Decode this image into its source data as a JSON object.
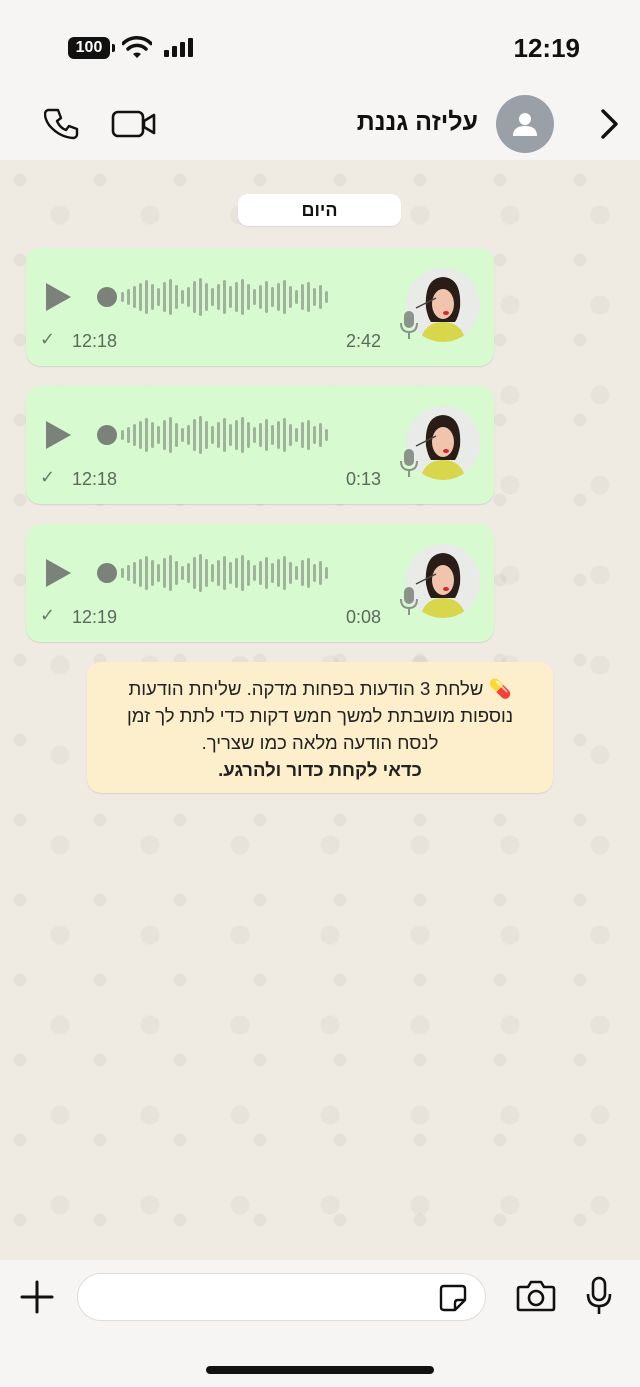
{
  "status_bar": {
    "battery": "100",
    "time": "12:19"
  },
  "header": {
    "contact_name": "עליזה גננת"
  },
  "chat": {
    "date_label": "היום",
    "voice_messages": [
      {
        "duration": "2:42",
        "time": "12:18"
      },
      {
        "duration": "0:13",
        "time": "12:18"
      },
      {
        "duration": "0:08",
        "time": "12:19"
      }
    ],
    "notice": {
      "emoji": "💊",
      "text": "שלחת 3 הודעות בפחות מדקה. שליחת הודעות נוספות מושבתת למשך חמש דקות כדי לתת לך זמן לנסח הודעה מלאה כמו שצריך.",
      "bold_text": "כדאי לקחת כדור ולהרגע."
    }
  },
  "composer": {
    "placeholder": ""
  },
  "icons": [
    "phone-icon",
    "video-icon",
    "person-icon",
    "chevron-right-icon",
    "play-icon",
    "mic-icon",
    "plus-icon",
    "sticker-icon",
    "camera-icon",
    "check-icon"
  ]
}
